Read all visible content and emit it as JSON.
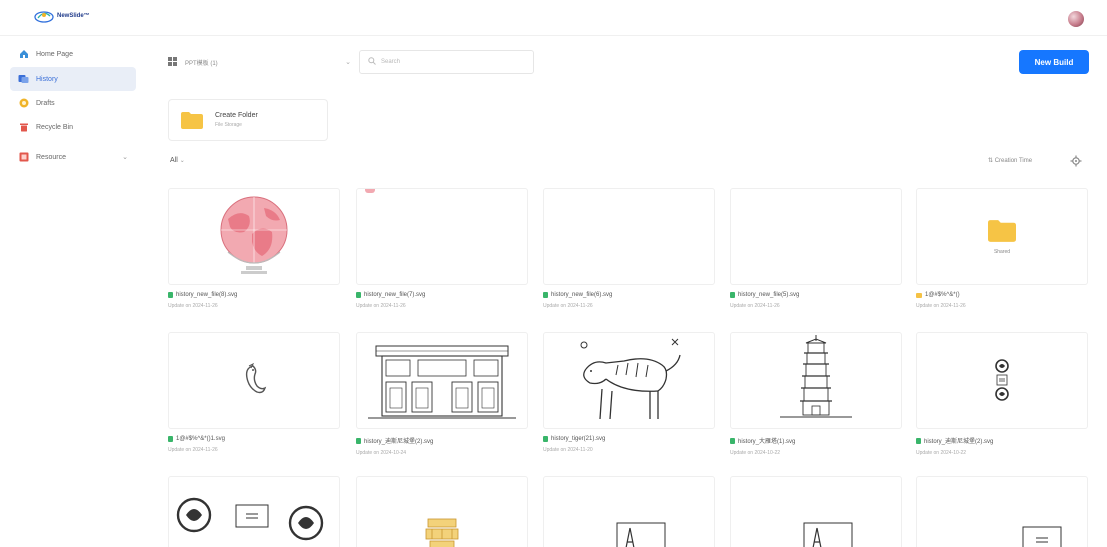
{
  "header": {
    "logo_text": "NewSlide™"
  },
  "sidebar": {
    "items": [
      {
        "label": "Home Page",
        "icon": "home-icon",
        "color": "#3a8fd8"
      },
      {
        "label": "History",
        "icon": "history-icon",
        "color": "#3a6fd8"
      },
      {
        "label": "Drafts",
        "icon": "drafts-icon",
        "color": "#f0b429"
      },
      {
        "label": "Recycle Bin",
        "icon": "trash-icon",
        "color": "#e2574c"
      },
      {
        "label": "Resource",
        "icon": "resource-icon",
        "color": "#e2574c"
      }
    ]
  },
  "toolbar": {
    "select_value": "PPT模板 (1)",
    "search_placeholder": "Search",
    "new_button_label": "New Build"
  },
  "create_folder": {
    "title": "Create Folder",
    "subtitle": "File Storage"
  },
  "filter": {
    "all_label": "All",
    "sort_label": "Creation Time"
  },
  "files": [
    {
      "name": "history_new_file(8).svg",
      "date": "Update on 2024-11-26",
      "type": "file",
      "thumb": "globe"
    },
    {
      "name": "history_new_file(7).svg",
      "date": "Update on 2024-11-26",
      "type": "file",
      "thumb": "blank-mark"
    },
    {
      "name": "history_new_file(6).svg",
      "date": "Update on 2024-11-26",
      "type": "file",
      "thumb": "blank"
    },
    {
      "name": "history_new_file(5).svg",
      "date": "Update on 2024-11-26",
      "type": "file",
      "thumb": "blank"
    },
    {
      "name": "1@#$%^&*()",
      "date": "Update on 2024-11-26",
      "type": "folder",
      "thumb": "folder",
      "shared_label": "Shared"
    },
    {
      "name": "1@#$%^&*()1.svg",
      "date": "Update on 2024-11-26",
      "type": "file",
      "thumb": "bird"
    },
    {
      "name": "history_迪斯尼城堡(2).svg",
      "date": "Update on 2024-10-24",
      "type": "file",
      "thumb": "building"
    },
    {
      "name": "history_tiger(21).svg",
      "date": "Update on 2024-11-20",
      "type": "file",
      "thumb": "tiger"
    },
    {
      "name": "history_大雁塔(1).svg",
      "date": "Update on 2024-10-22",
      "type": "file",
      "thumb": "pagoda"
    },
    {
      "name": "history_迪斯尼城堡(2).svg",
      "date": "Update on 2024-10-22",
      "type": "file",
      "thumb": "emblem"
    },
    {
      "name": "",
      "date": "",
      "type": "file",
      "thumb": "emblem-pair"
    },
    {
      "name": "",
      "date": "",
      "type": "file",
      "thumb": "ornament"
    },
    {
      "name": "",
      "date": "",
      "type": "file",
      "thumb": "tower-card"
    },
    {
      "name": "",
      "date": "",
      "type": "file",
      "thumb": "tower-card"
    },
    {
      "name": "",
      "date": "",
      "type": "file",
      "thumb": "small-card"
    }
  ]
}
